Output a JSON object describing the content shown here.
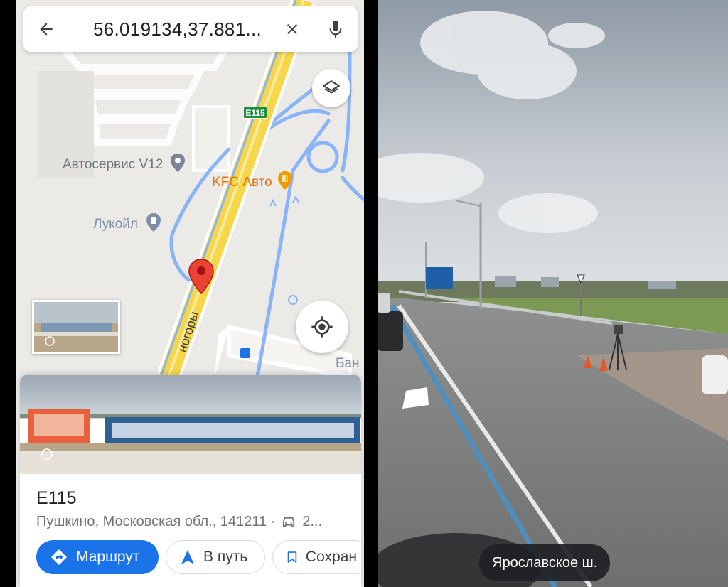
{
  "search": {
    "query": "56.019134,37.881...",
    "back_icon": "arrow-back-icon",
    "clear_icon": "close-icon",
    "mic_icon": "mic-icon"
  },
  "map": {
    "labels": {
      "autoservice": "Автосервис V12",
      "kfc": "KFC Авто",
      "lukoil": "Лукойл",
      "road_name": "ногоры",
      "bank": "Бан"
    },
    "road_shield": "E115",
    "layers_icon": "layers-icon",
    "locate_icon": "my-location-icon"
  },
  "place": {
    "title": "E115",
    "address": "Пушкино, Московская обл., 141211 ·",
    "drive_time": "2...",
    "actions": {
      "route": "Маршрут",
      "go": "В путь",
      "save": "Сохран"
    }
  },
  "street_view": {
    "caption": "Ярославское ш."
  },
  "colors": {
    "accent": "#1a73e8",
    "pin": "#ea4335",
    "highway": "#f7d64a",
    "road_blue": "#8ab4f8"
  }
}
